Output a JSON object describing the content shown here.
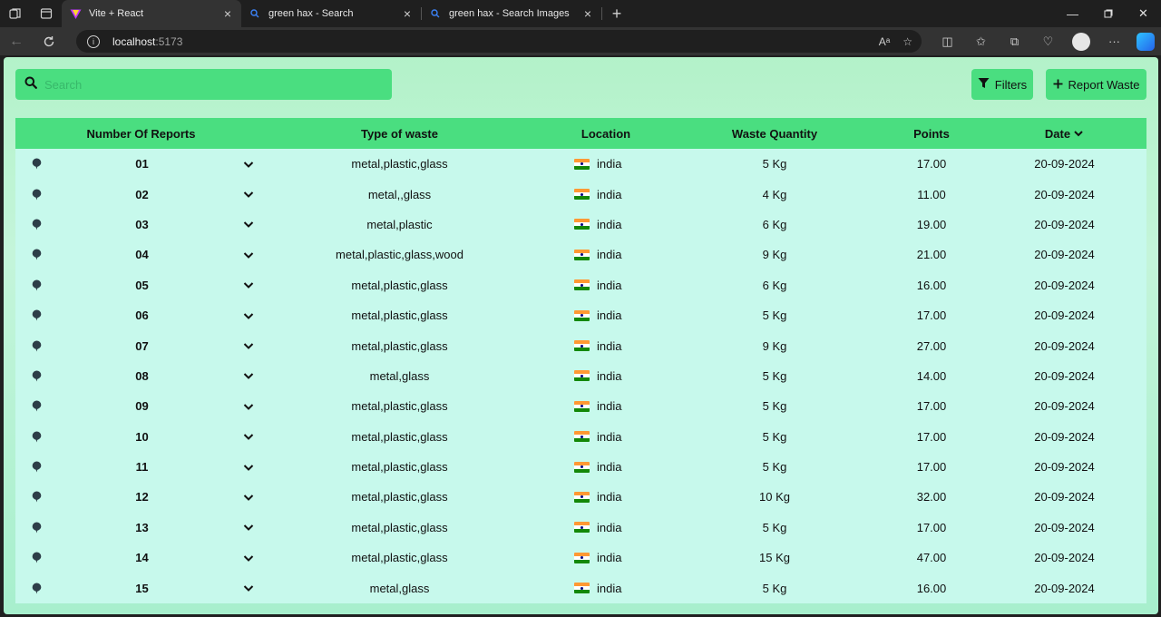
{
  "browser": {
    "tabs": [
      {
        "title": "Vite + React",
        "active": true,
        "icon": "vite-icon"
      },
      {
        "title": "green hax - Search",
        "active": false,
        "icon": "search-icon"
      },
      {
        "title": "green hax - Search Images",
        "active": false,
        "icon": "search-icon"
      }
    ],
    "url_host": "localhost",
    "url_port": ":5173"
  },
  "search": {
    "placeholder": "Search"
  },
  "toolbar": {
    "filters_label": "Filters",
    "report_label": "Report Waste"
  },
  "table": {
    "headers": {
      "reports": "Number Of Reports",
      "type": "Type of waste",
      "location": "Location",
      "quantity": "Waste Quantity",
      "points": "Points",
      "date": "Date"
    },
    "rows": [
      {
        "num": "01",
        "type": "metal,plastic,glass",
        "location": "india",
        "quantity": "5 Kg",
        "points": "17.00",
        "date": "20-09-2024"
      },
      {
        "num": "02",
        "type": "metal,,glass",
        "location": "india",
        "quantity": "4 Kg",
        "points": "11.00",
        "date": "20-09-2024"
      },
      {
        "num": "03",
        "type": "metal,plastic",
        "location": "india",
        "quantity": "6 Kg",
        "points": "19.00",
        "date": "20-09-2024"
      },
      {
        "num": "04",
        "type": "metal,plastic,glass,wood",
        "location": "india",
        "quantity": "9 Kg",
        "points": "21.00",
        "date": "20-09-2024"
      },
      {
        "num": "05",
        "type": "metal,plastic,glass",
        "location": "india",
        "quantity": "6 Kg",
        "points": "16.00",
        "date": "20-09-2024"
      },
      {
        "num": "06",
        "type": "metal,plastic,glass",
        "location": "india",
        "quantity": "5 Kg",
        "points": "17.00",
        "date": "20-09-2024"
      },
      {
        "num": "07",
        "type": "metal,plastic,glass",
        "location": "india",
        "quantity": "9 Kg",
        "points": "27.00",
        "date": "20-09-2024"
      },
      {
        "num": "08",
        "type": "metal,glass",
        "location": "india",
        "quantity": "5 Kg",
        "points": "14.00",
        "date": "20-09-2024"
      },
      {
        "num": "09",
        "type": "metal,plastic,glass",
        "location": "india",
        "quantity": "5 Kg",
        "points": "17.00",
        "date": "20-09-2024"
      },
      {
        "num": "10",
        "type": "metal,plastic,glass",
        "location": "india",
        "quantity": "5 Kg",
        "points": "17.00",
        "date": "20-09-2024"
      },
      {
        "num": "11",
        "type": "metal,plastic,glass",
        "location": "india",
        "quantity": "5 Kg",
        "points": "17.00",
        "date": "20-09-2024"
      },
      {
        "num": "12",
        "type": "metal,plastic,glass",
        "location": "india",
        "quantity": "10 Kg",
        "points": "32.00",
        "date": "20-09-2024"
      },
      {
        "num": "13",
        "type": "metal,plastic,glass",
        "location": "india",
        "quantity": "5 Kg",
        "points": "17.00",
        "date": "20-09-2024"
      },
      {
        "num": "14",
        "type": "metal,plastic,glass",
        "location": "india",
        "quantity": "15 Kg",
        "points": "47.00",
        "date": "20-09-2024"
      },
      {
        "num": "15",
        "type": "metal,glass",
        "location": "india",
        "quantity": "5 Kg",
        "points": "16.00",
        "date": "20-09-2024"
      }
    ]
  },
  "colors": {
    "accent": "#4ade80",
    "row_bg": "#c7f9ec",
    "panel_bg": "#b3f2c9"
  }
}
